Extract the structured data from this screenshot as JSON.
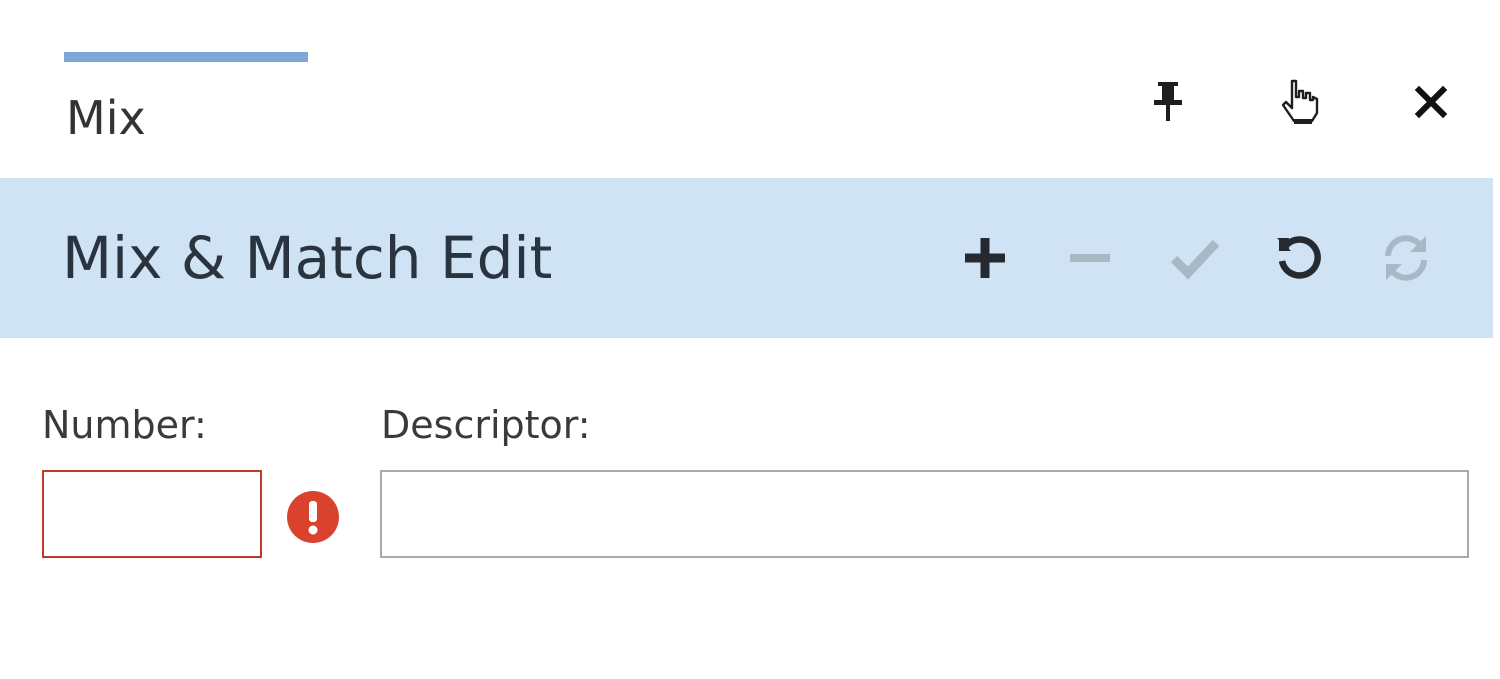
{
  "tabs": [
    {
      "label": "Mix",
      "active": true
    }
  ],
  "window_controls": {
    "pin_icon": "pin-icon",
    "pointer_icon": "hand-pointer-icon",
    "close_icon": "close-icon"
  },
  "header": {
    "title": "Mix & Match Edit",
    "toolbar": [
      {
        "icon": "plus-icon",
        "enabled": true
      },
      {
        "icon": "minus-icon",
        "enabled": false
      },
      {
        "icon": "check-icon",
        "enabled": false
      },
      {
        "icon": "undo-icon",
        "enabled": true
      },
      {
        "icon": "refresh-icon",
        "enabled": false
      }
    ]
  },
  "form": {
    "number": {
      "label": "Number:",
      "value": "",
      "placeholder": "",
      "has_error": true
    },
    "descriptor": {
      "label": "Descriptor:",
      "value": "",
      "placeholder": ""
    }
  },
  "colors": {
    "tab_indicator": "#7ea7d8",
    "header_bg": "#cfe3f5",
    "error": "#d9432e",
    "error_border": "#c0392b",
    "icon_enabled": "#2b2b2b",
    "icon_disabled": "#aab8c4"
  }
}
